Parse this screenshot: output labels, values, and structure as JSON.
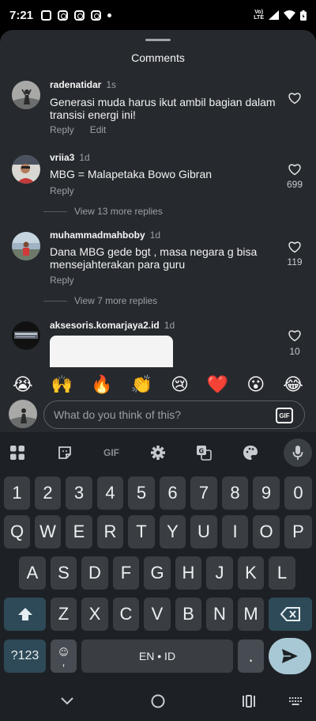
{
  "status_bar": {
    "time": "7:21",
    "network": "Vo)\nLTE"
  },
  "sheet": {
    "title": "Comments"
  },
  "comments": [
    {
      "username": "radenatidar",
      "time": "1s",
      "text": "Generasi muda harus ikut ambil bagian dalam transisi energi ini!",
      "reply_label": "Reply",
      "edit_label": "Edit",
      "likes": ""
    },
    {
      "username": "vriia3",
      "time": "1d",
      "text": "MBG = Malapetaka Bowo Gibran",
      "reply_label": "Reply",
      "likes": "699",
      "more_replies": "View 13 more replies"
    },
    {
      "username": "muhammadmahboby",
      "time": "1d",
      "text": "Dana MBG gede bgt , masa negara g bisa mensejahterakan para guru",
      "reply_label": "Reply",
      "likes": "119",
      "more_replies": "View 7 more replies"
    },
    {
      "username": "aksesoris.komarjaya2.id",
      "time": "1d",
      "text": "",
      "likes": "10"
    }
  ],
  "emoji_bar": [
    "😭",
    "🙌",
    "🔥",
    "👏",
    "😢",
    "❤️",
    "😮",
    "😂"
  ],
  "compose": {
    "placeholder": "What do you think of this?",
    "gif_label": "GIF"
  },
  "keyboard": {
    "toolbar": {
      "gif_label": "GIF"
    },
    "number_row": [
      "1",
      "2",
      "3",
      "4",
      "5",
      "6",
      "7",
      "8",
      "9",
      "0"
    ],
    "row1": [
      "Q",
      "W",
      "E",
      "R",
      "T",
      "Y",
      "U",
      "I",
      "O",
      "P"
    ],
    "row2": [
      "A",
      "S",
      "D",
      "F",
      "G",
      "H",
      "J",
      "K",
      "L"
    ],
    "row3": [
      "Z",
      "X",
      "C",
      "V",
      "B",
      "N",
      "M"
    ],
    "symbols_label": "?123",
    "emoji_key": "☺",
    "comma": ",",
    "space_label": "EN • ID",
    "period": "."
  },
  "colors": {
    "sheet_bg": "#262a2e",
    "keyboard_bg": "#1d2125",
    "key_bg": "#3a3e43",
    "accent_key": "#2e4a58",
    "send_button": "#a9c8d6"
  }
}
